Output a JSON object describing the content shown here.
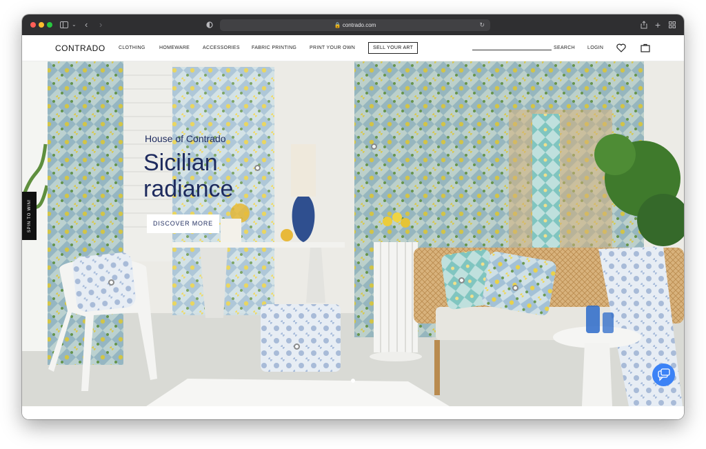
{
  "browser": {
    "url": "contrado.com"
  },
  "nav": {
    "logo": "CONTRADO",
    "links": [
      "CLOTHING",
      "HOMEWARE",
      "ACCESSORIES",
      "FABRIC PRINTING",
      "PRINT YOUR OWN"
    ],
    "sell_button": "SELL YOUR ART",
    "search": "SEARCH",
    "login": "LOGIN"
  },
  "hero": {
    "kicker": "House of Contrado",
    "title": "Sicilian radiance",
    "cta": "DISCOVER MORE",
    "spin_tab": "SPIN TO WIN!"
  },
  "colors": {
    "brand_navy": "#1e2b5e",
    "chat_blue": "#3b82f6",
    "titlebar": "#2f2f31"
  }
}
